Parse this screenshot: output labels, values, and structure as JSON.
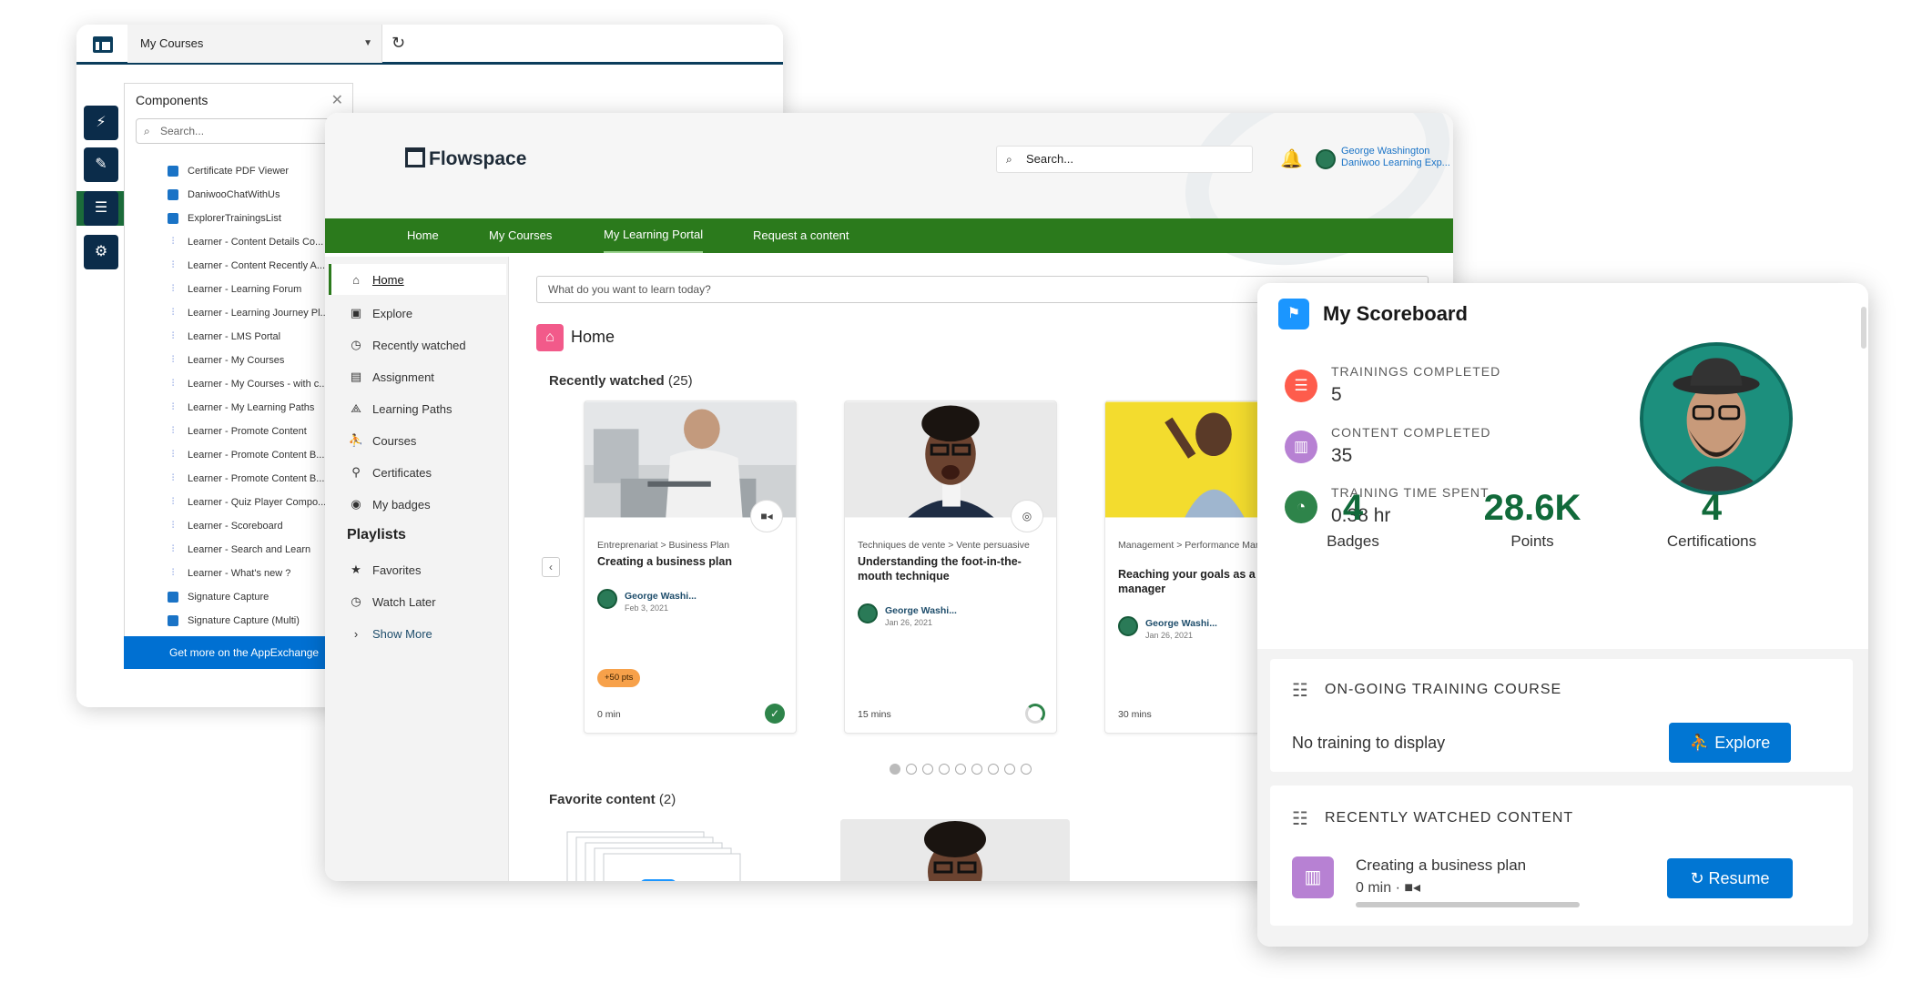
{
  "builder": {
    "page_select": "My Courses",
    "components_title": "Components",
    "search_placeholder": "Search...",
    "components": [
      {
        "label": "Certificate PDF Viewer",
        "icon": "lightning-icon"
      },
      {
        "label": "DaniwooChatWithUs",
        "icon": "lightning-icon"
      },
      {
        "label": "ExplorerTrainingsList",
        "icon": "lightning-icon"
      },
      {
        "label": "Learner - Content Details Co...",
        "icon": "bars-icon"
      },
      {
        "label": "Learner - Content Recently A...",
        "icon": "bars-icon"
      },
      {
        "label": "Learner - Learning Forum",
        "icon": "bars-icon"
      },
      {
        "label": "Learner - Learning Journey Pl...",
        "icon": "bars-icon"
      },
      {
        "label": "Learner - LMS Portal",
        "icon": "bars-icon"
      },
      {
        "label": "Learner - My Courses",
        "icon": "bars-icon"
      },
      {
        "label": "Learner - My Courses - with c...",
        "icon": "bars-icon"
      },
      {
        "label": "Learner - My Learning Paths",
        "icon": "bars-icon"
      },
      {
        "label": "Learner - Promote Content",
        "icon": "bars-icon"
      },
      {
        "label": "Learner - Promote Content B...",
        "icon": "bars-icon"
      },
      {
        "label": "Learner - Promote Content B...",
        "icon": "bars-icon"
      },
      {
        "label": "Learner - Quiz Player Compo...",
        "icon": "bars-icon"
      },
      {
        "label": "Learner - Scoreboard",
        "icon": "bars-icon"
      },
      {
        "label": "Learner - Search and Learn",
        "icon": "bars-icon"
      },
      {
        "label": "Learner - What's new ?",
        "icon": "bars-icon"
      },
      {
        "label": "Signature Capture",
        "icon": "lightning-icon"
      },
      {
        "label": "Signature Capture (Multi)",
        "icon": "lightning-icon"
      }
    ],
    "appexchange": "Get more on the AppExchange"
  },
  "portal": {
    "logo": "Flowspace",
    "search_placeholder": "Search...",
    "user_name": "George Washington",
    "user_org": "Daniwoo Learning Exp...",
    "nav": [
      "Home",
      "My Courses",
      "My Learning Portal",
      "Request a content"
    ],
    "sidebar": [
      {
        "label": "Home",
        "icon": "home-icon"
      },
      {
        "label": "Explore",
        "icon": "explore-icon"
      },
      {
        "label": "Recently watched",
        "icon": "clock-icon"
      },
      {
        "label": "Assignment",
        "icon": "assignment-icon"
      },
      {
        "label": "Learning Paths",
        "icon": "learning-paths-icon"
      },
      {
        "label": "Courses",
        "icon": "courses-icon"
      },
      {
        "label": "Certificates",
        "icon": "certificate-icon"
      },
      {
        "label": "My badges",
        "icon": "badge-icon"
      }
    ],
    "playlists_heading": "Playlists",
    "playlists": [
      {
        "label": "Favorites",
        "icon": "star-icon"
      },
      {
        "label": "Watch Later",
        "icon": "clock-icon"
      }
    ],
    "show_more": "Show More",
    "learn_placeholder": "What do you want to learn today?",
    "home_title": "Home",
    "recently_watched_title": "Recently watched",
    "recently_watched_count": "(25)",
    "favorite_title": "Favorite content",
    "favorite_count": "(2)",
    "cards": [
      {
        "path": "Entreprenariat > Business Plan",
        "title": "Creating a business plan",
        "author": "George Washi...",
        "date": "Feb 3, 2021",
        "points": "+50 pts",
        "duration": "0 min",
        "type_icon": "video-icon",
        "status": "completed"
      },
      {
        "path": "Techniques de vente > Vente persuasive",
        "title": "Understanding the foot-in-the-mouth technique",
        "author": "George Washi...",
        "date": "Jan 26, 2021",
        "points": "",
        "duration": "15 mins",
        "type_icon": "web-icon",
        "status": "in-progress"
      },
      {
        "path": "Management > Performance Management",
        "title": "Reaching your goals as a manager",
        "author": "George Washi...",
        "date": "Jan 26, 2021",
        "points": "",
        "duration": "30 mins",
        "type_icon": "",
        "status": ""
      }
    ],
    "carousel_pages": 9,
    "carousel_current": 1
  },
  "scoreboard": {
    "title": "My Scoreboard",
    "stats": [
      {
        "label": "TRAININGS COMPLETED",
        "value": "5",
        "icon": "trainings-icon",
        "color": "#fe5c4c"
      },
      {
        "label": "CONTENT COMPLETED",
        "value": "35",
        "icon": "content-icon",
        "color": "#b781d3"
      },
      {
        "label": "TRAINING TIME SPENT",
        "value": "0.38 hr",
        "icon": "timer-icon",
        "color": "#2e844a"
      }
    ],
    "totals": [
      {
        "value": "4",
        "label": "Badges"
      },
      {
        "value": "28.6K",
        "label": "Points"
      },
      {
        "value": "4",
        "label": "Certifications"
      }
    ],
    "ongoing_title": "ON-GOING TRAINING COURSE",
    "ongoing_empty": "No training to display",
    "explore_button": "Explore",
    "recent_title": "RECENTLY WATCHED CONTENT",
    "recent_item_title": "Creating a business plan",
    "recent_item_duration": "0 min",
    "recent_item_progress": 0,
    "resume_button": "Resume"
  },
  "colors": {
    "nav_green": "#2b7a1c",
    "brand_blue": "#0176d3",
    "stat_green": "#116a3a",
    "builder_navy": "#0b2c4a"
  }
}
